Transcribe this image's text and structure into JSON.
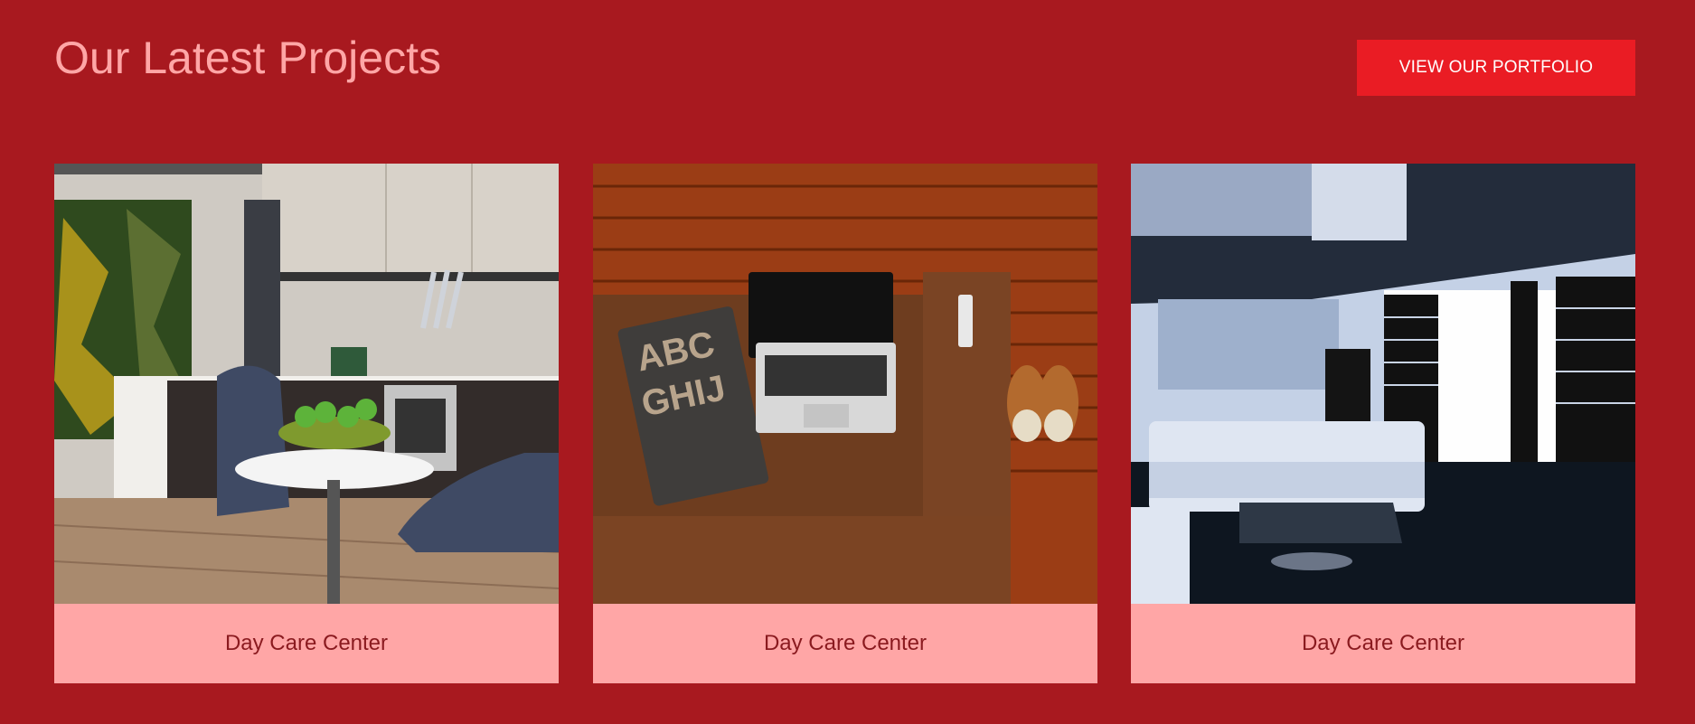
{
  "section": {
    "title": "Our Latest Projects"
  },
  "portfolio_button": {
    "label": "VIEW OUR PORTFOLIO"
  },
  "projects": [
    {
      "caption": "Day Care Center",
      "image": "kitchen-interior"
    },
    {
      "caption": "Day Care Center",
      "image": "laptop-on-sofa"
    },
    {
      "caption": "Day Care Center",
      "image": "living-room-interior"
    }
  ],
  "colors": {
    "background": "#a8191f",
    "title": "#ffa6a6",
    "button": "#ea1c24",
    "caption_bg": "#ffa6a6",
    "caption_text": "#8a1a1f"
  }
}
